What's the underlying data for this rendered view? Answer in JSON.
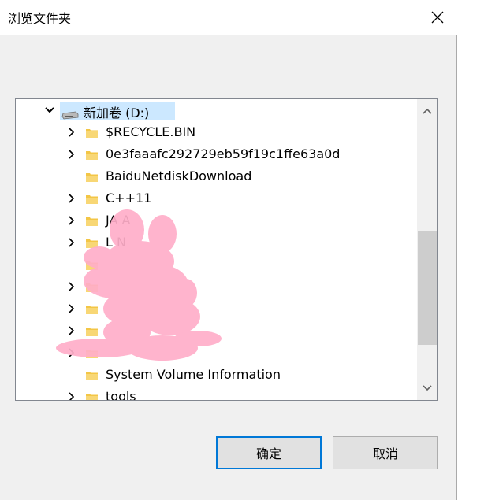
{
  "dialog": {
    "title": "浏览文件夹",
    "ok_label": "确定",
    "cancel_label": "取消"
  },
  "tree": {
    "root": {
      "label": "新加卷 (D:)",
      "expanded": true,
      "selected": true,
      "icon": "drive-icon"
    },
    "items": [
      {
        "label": "$RECYCLE.BIN",
        "has_children": true
      },
      {
        "label": "0e3faaafc292729eb59f19c1ffe63a0d",
        "has_children": true
      },
      {
        "label": "BaiduNetdiskDownload",
        "has_children": false
      },
      {
        "label": "C++11",
        "has_children": true
      },
      {
        "label": "JA A",
        "has_children": true,
        "obscured": true
      },
      {
        "label": "L N",
        "has_children": true,
        "obscured": true
      },
      {
        "label": "",
        "has_children": false,
        "obscured": true
      },
      {
        "label": "",
        "has_children": true,
        "obscured": true
      },
      {
        "label": "",
        "has_children": true,
        "obscured": true
      },
      {
        "label": "",
        "has_children": true,
        "obscured": true
      },
      {
        "label": "",
        "has_children": true,
        "obscured": true
      },
      {
        "label": "System Volume Information",
        "has_children": false
      },
      {
        "label": "tools",
        "has_children": true
      }
    ]
  },
  "colors": {
    "selection": "#cce8ff",
    "folder": "#f3c646",
    "accent": "#0078d7",
    "scribble": "#ffaec9"
  }
}
